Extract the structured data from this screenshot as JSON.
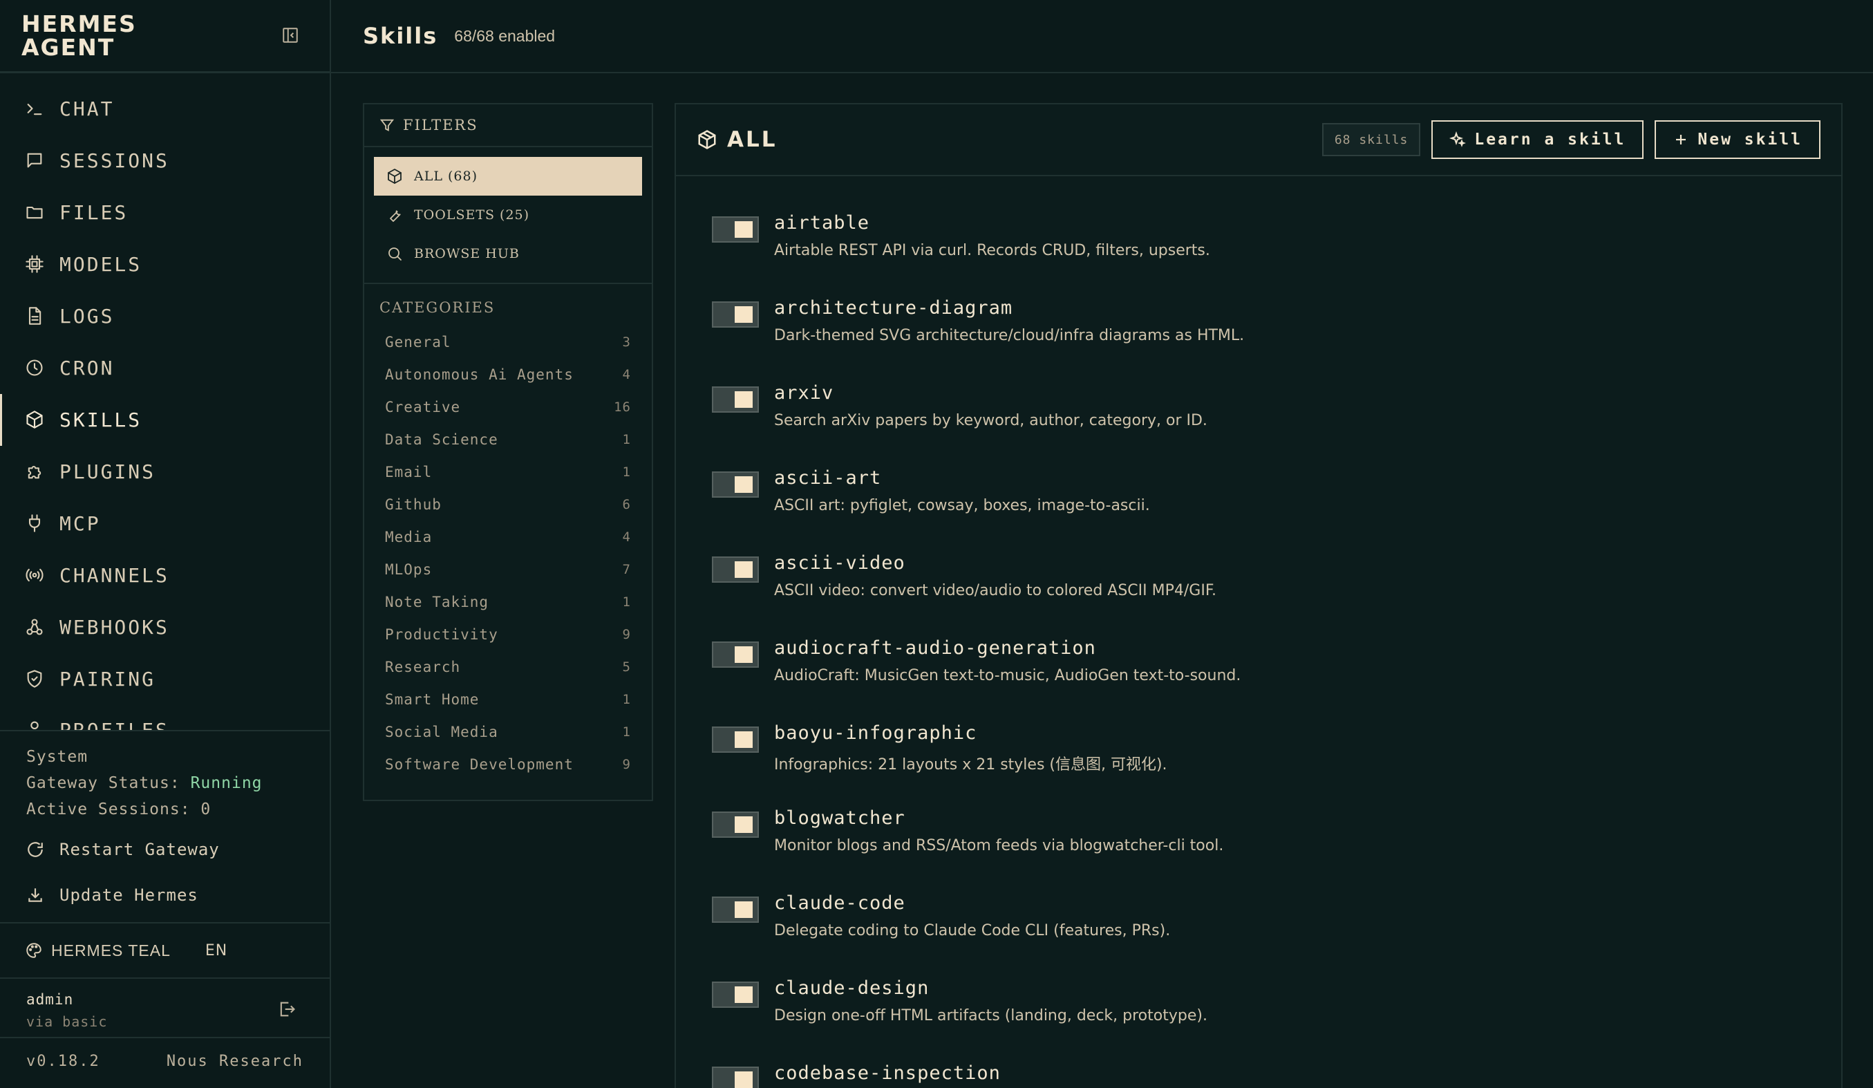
{
  "brand": {
    "title": "HERMES\nAGENT"
  },
  "nav": [
    {
      "id": "chat",
      "label": "CHAT",
      "icon": "terminal-icon"
    },
    {
      "id": "sessions",
      "label": "SESSIONS",
      "icon": "message-square-icon"
    },
    {
      "id": "files",
      "label": "FILES",
      "icon": "folder-icon"
    },
    {
      "id": "models",
      "label": "MODELS",
      "icon": "cpu-icon"
    },
    {
      "id": "logs",
      "label": "LOGS",
      "icon": "file-text-icon"
    },
    {
      "id": "cron",
      "label": "CRON",
      "icon": "clock-icon"
    },
    {
      "id": "skills",
      "label": "SKILLS",
      "icon": "package-icon",
      "active": true
    },
    {
      "id": "plugins",
      "label": "PLUGINS",
      "icon": "puzzle-icon"
    },
    {
      "id": "mcp",
      "label": "MCP",
      "icon": "plug-icon"
    },
    {
      "id": "channels",
      "label": "CHANNELS",
      "icon": "radio-icon"
    },
    {
      "id": "webhooks",
      "label": "WEBHOOKS",
      "icon": "webhook-icon"
    },
    {
      "id": "pairing",
      "label": "PAIRING",
      "icon": "shield-icon"
    },
    {
      "id": "profiles",
      "label": "PROFILES",
      "icon": "user-icon"
    }
  ],
  "system": {
    "heading": "System",
    "gateway_label": "Gateway Status:",
    "gateway_status": "Running",
    "sessions_label": "Active Sessions:",
    "sessions_count": "0",
    "restart_label": "Restart Gateway",
    "update_label": "Update Hermes"
  },
  "theme": {
    "label": "HERMES TEAL",
    "lang": "EN"
  },
  "user": {
    "name": "admin",
    "via": "via basic"
  },
  "footer": {
    "version": "v0.18.2",
    "org": "Nous Research"
  },
  "header": {
    "title": "Skills",
    "subtitle": "68/68 enabled"
  },
  "filters": {
    "heading": "FILTERS",
    "options": [
      {
        "label": "ALL (68)",
        "icon": "package-icon",
        "active": true
      },
      {
        "label": "TOOLSETS (25)",
        "icon": "wrench-icon"
      },
      {
        "label": "BROWSE HUB",
        "icon": "search-icon"
      }
    ],
    "categories_heading": "CATEGORIES",
    "categories": [
      {
        "name": "General",
        "count": "3"
      },
      {
        "name": "Autonomous Ai Agents",
        "count": "4"
      },
      {
        "name": "Creative",
        "count": "16"
      },
      {
        "name": "Data Science",
        "count": "1"
      },
      {
        "name": "Email",
        "count": "1"
      },
      {
        "name": "Github",
        "count": "6"
      },
      {
        "name": "Media",
        "count": "4"
      },
      {
        "name": "MLOps",
        "count": "7"
      },
      {
        "name": "Note Taking",
        "count": "1"
      },
      {
        "name": "Productivity",
        "count": "9"
      },
      {
        "name": "Research",
        "count": "5"
      },
      {
        "name": "Smart Home",
        "count": "1"
      },
      {
        "name": "Social Media",
        "count": "1"
      },
      {
        "name": "Software Development",
        "count": "9"
      }
    ]
  },
  "skills_panel": {
    "title": "ALL",
    "count_badge": "68 skills",
    "learn_label": "Learn a skill",
    "new_label": "New skill",
    "items": [
      {
        "name": "airtable",
        "desc": "Airtable REST API via curl. Records CRUD, filters, upserts.",
        "enabled": true
      },
      {
        "name": "architecture-diagram",
        "desc": "Dark-themed SVG architecture/cloud/infra diagrams as HTML.",
        "enabled": true
      },
      {
        "name": "arxiv",
        "desc": "Search arXiv papers by keyword, author, category, or ID.",
        "enabled": true
      },
      {
        "name": "ascii-art",
        "desc": "ASCII art: pyfiglet, cowsay, boxes, image-to-ascii.",
        "enabled": true
      },
      {
        "name": "ascii-video",
        "desc": "ASCII video: convert video/audio to colored ASCII MP4/GIF.",
        "enabled": true
      },
      {
        "name": "audiocraft-audio-generation",
        "desc": "AudioCraft: MusicGen text-to-music, AudioGen text-to-sound.",
        "enabled": true
      },
      {
        "name": "baoyu-infographic",
        "desc": "Infographics: 21 layouts x 21 styles (信息图, 可视化).",
        "enabled": true
      },
      {
        "name": "blogwatcher",
        "desc": "Monitor blogs and RSS/Atom feeds via blogwatcher-cli tool.",
        "enabled": true
      },
      {
        "name": "claude-code",
        "desc": "Delegate coding to Claude Code CLI (features, PRs).",
        "enabled": true
      },
      {
        "name": "claude-design",
        "desc": "Design one-off HTML artifacts (landing, deck, prototype).",
        "enabled": true
      },
      {
        "name": "codebase-inspection",
        "desc": "",
        "enabled": true
      }
    ]
  },
  "colors": {
    "bg": "#0b1a1a",
    "accent": "#e5d3b8",
    "text": "#e8dcc6",
    "status_ok": "#8fd6a6"
  }
}
